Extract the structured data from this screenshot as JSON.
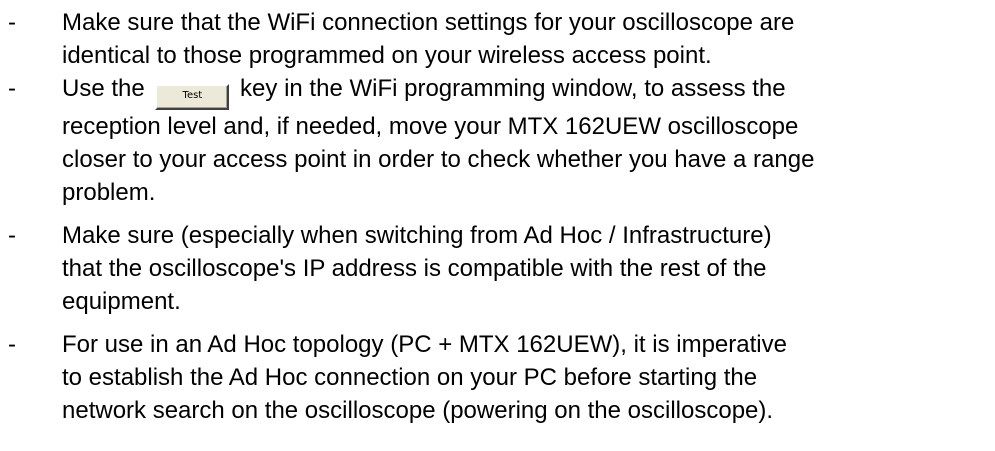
{
  "bullet_symbol": "-",
  "items": [
    {
      "lines": [
        "Make sure that the WiFi connection settings for your oscilloscope are",
        "identical to those programmed on your wireless access point."
      ]
    },
    {
      "line1_before": "Use the",
      "button_label": "Test",
      "line1_after": "key in the WiFi programming window, to assess the",
      "lines": [
        "reception level and, if needed, move your MTX 162UEW oscilloscope",
        "closer to your access point in order to check whether you have a range",
        "problem."
      ]
    },
    {
      "lines": [
        "Make sure (especially when switching from Ad Hoc / Infrastructure)",
        "that the oscilloscope's IP address is compatible with the rest of the",
        "equipment."
      ]
    },
    {
      "lines": [
        "For use in an Ad Hoc topology (PC + MTX 162UEW), it is imperative",
        "to establish the Ad Hoc connection on your PC before starting the",
        "network search on the oscilloscope (powering on the oscilloscope)."
      ]
    }
  ]
}
